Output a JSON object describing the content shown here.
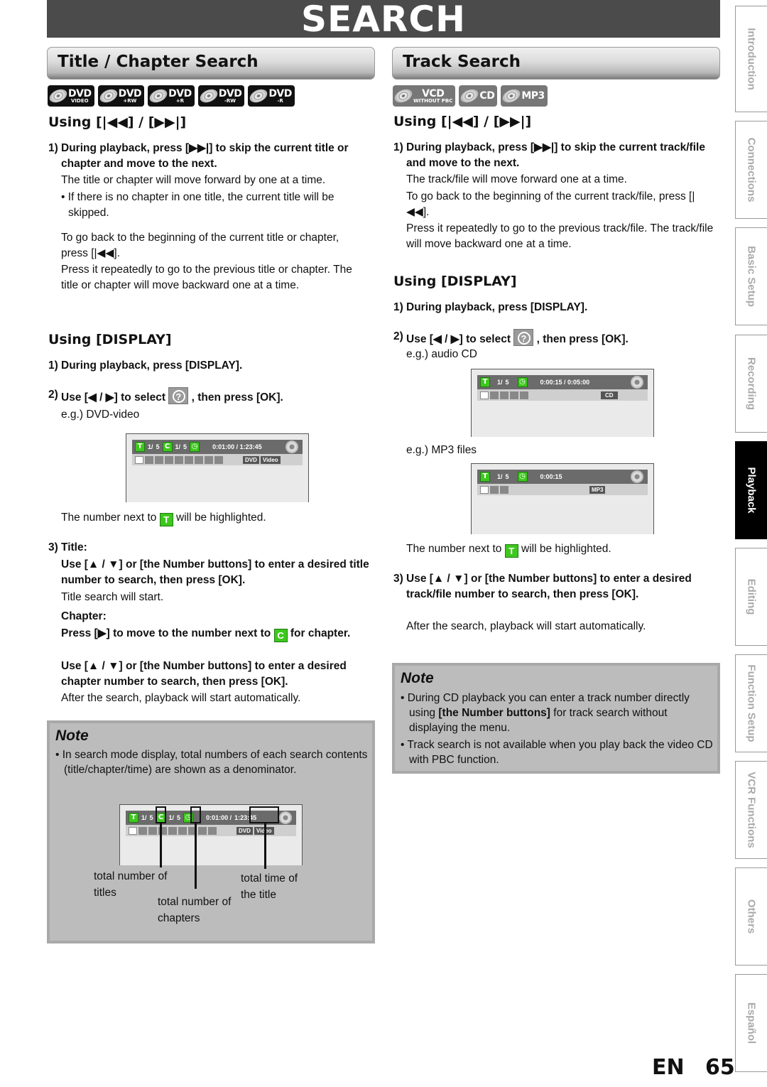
{
  "page": {
    "title": "SEARCH",
    "language": "EN",
    "page_number": "65"
  },
  "side_tabs": [
    {
      "label": "Introduction",
      "active": false
    },
    {
      "label": "Connections",
      "active": false
    },
    {
      "label": "Basic Setup",
      "active": false
    },
    {
      "label": "Recording",
      "active": false
    },
    {
      "label": "Playback",
      "active": true
    },
    {
      "label": "Editing",
      "active": false
    },
    {
      "label": "Function Setup",
      "active": false
    },
    {
      "label": "VCR Functions",
      "active": false
    },
    {
      "label": "Others",
      "active": false
    },
    {
      "label": "Español",
      "active": false
    }
  ],
  "left": {
    "section_title": "Title / Chapter Search",
    "badges": [
      {
        "main": "DVD",
        "sub": "VIDEO"
      },
      {
        "main": "DVD",
        "sub": "+RW"
      },
      {
        "main": "DVD",
        "sub": "+R"
      },
      {
        "main": "DVD",
        "sub": "-RW"
      },
      {
        "main": "DVD",
        "sub": "-R"
      }
    ],
    "using_skip": {
      "heading": "Using [|◀◀] / [▶▶|]",
      "step1_num": "1)",
      "step1": "During playback, press [▶▶|] to skip the current title or chapter and move to the next.",
      "p1": "The title or chapter will move forward by one at a time.",
      "bullet": "• If there is no chapter in one title, the current title will be skipped.",
      "p2": "To go back to the beginning of the current title or chapter, press [|◀◀].",
      "p3": "Press it repeatedly to go to the previous title or chapter. The title or chapter will move backward one at a time."
    },
    "using_display": {
      "heading": "Using [DISPLAY]",
      "step1_num": "1)",
      "step1": "During playback, press [DISPLAY].",
      "step2_num": "2)",
      "step2_a": "Use [◀ / ▶] to select",
      "step2_b": ", then press [OK].",
      "example": "e.g.) DVD-video",
      "highlight_a": "The number next to",
      "highlight_icon": "T",
      "highlight_b": "will be highlighted.",
      "step3_num": "3)",
      "step3_title": "Title:",
      "step3_title_instr": "Use [▲ / ▼] or [the Number buttons] to enter a desired title number to search, then press [OK].",
      "step3_title_result": "Title search will start.",
      "step3_chapter": "Chapter:",
      "step3_chapter_a": "Press [▶] to move to the number next to",
      "step3_chapter_icon": "C",
      "step3_chapter_b": "for chapter.",
      "step3_chapter_instr": "Use [▲ / ▼] or [the Number buttons] to enter a desired chapter number to search, then press [OK].",
      "step3_result": "After the search, playback will start automatically."
    },
    "osd": {
      "t_icon": "T",
      "title_cur": "1/",
      "title_total": "5",
      "c_icon": "C",
      "chapter_cur": "1/",
      "chapter_total": "5",
      "time": "0:01:00 / 1:23:45",
      "labels": [
        "DVD",
        "Video"
      ]
    },
    "note": {
      "title": "Note",
      "items": [
        "In search mode display, total numbers of each search contents (title/chapter/time) are shown as a denominator."
      ],
      "osd": {
        "title_cur": "1/",
        "title_total": "5",
        "chapter_cur": "1/",
        "chapter_total": "5",
        "time_elapsed": "0:01:00 /",
        "time_total": "1:23:45",
        "labels": [
          "DVD",
          "Video"
        ]
      },
      "callouts": [
        "total number of titles",
        "total number of chapters",
        "total time of the title"
      ]
    }
  },
  "right": {
    "section_title": "Track Search",
    "badges": [
      {
        "main": "VCD",
        "sub": "WITHOUT PBC"
      },
      {
        "main": "CD",
        "sub": ""
      },
      {
        "main": "MP3",
        "sub": ""
      }
    ],
    "using_skip": {
      "heading": "Using [|◀◀] / [▶▶|]",
      "step1_num": "1)",
      "step1": "During playback, press [▶▶|] to skip the current track/file and move to the next.",
      "p1": "The track/file will move forward one at a time.",
      "p2": "To go back to the beginning of the current track/file, press [|◀◀].",
      "p3": "Press it repeatedly to go to the previous track/file. The track/file will move backward one at a time."
    },
    "using_display": {
      "heading": "Using [DISPLAY]",
      "step1_num": "1)",
      "step1": "During playback, press [DISPLAY].",
      "step2_num": "2)",
      "step2_a": "Use [◀ / ▶] to select",
      "step2_b": ", then press [OK].",
      "example_cd": "e.g.) audio CD",
      "example_mp3": "e.g.) MP3 files",
      "highlight_a": "The number next to",
      "highlight_icon": "T",
      "highlight_b": "will be highlighted.",
      "step3_num": "3)",
      "step3": "Use [▲ / ▼] or [the Number buttons] to enter a desired track/file number to search, then press [OK].",
      "step3_result": "After the search, playback will start automatically."
    },
    "osd_cd": {
      "t_icon": "T",
      "cur": "1/",
      "total": "5",
      "time": "0:00:15 / 0:05:00",
      "label": "CD"
    },
    "osd_mp3": {
      "t_icon": "T",
      "cur": "1/",
      "total": "5",
      "time": "0:00:15",
      "label": "MP3"
    },
    "note": {
      "title": "Note",
      "item1_a": "During CD playback you can enter a track number directly using",
      "item1_bold": "[the Number buttons]",
      "item1_b": "for track search without displaying the menu.",
      "item2": "Track search is not available when you play back the video CD with PBC function."
    }
  }
}
